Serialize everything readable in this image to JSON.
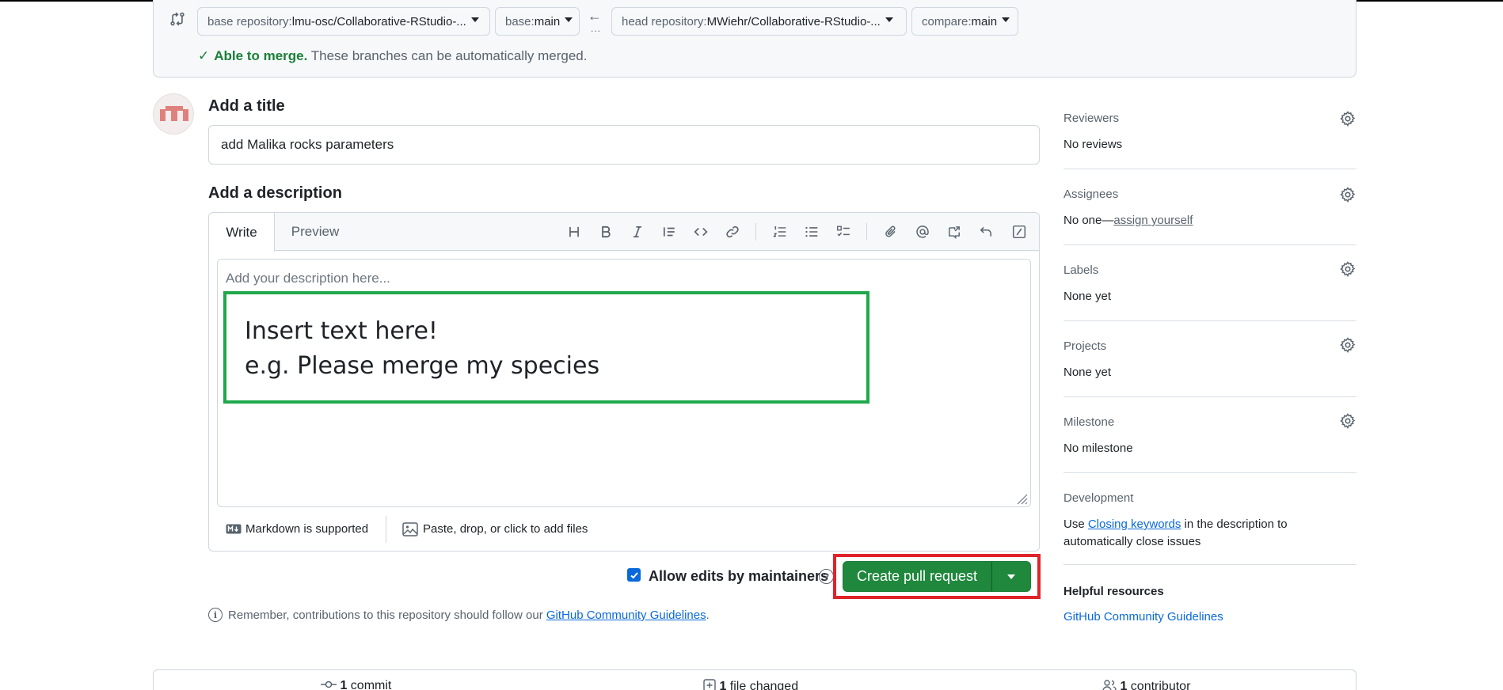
{
  "compare": {
    "base_repo_label": "base repository: ",
    "base_repo_value": "lmu-osc/Collaborative-RStudio-...",
    "base_label": "base: ",
    "base_value": "main",
    "arrow": "←",
    "arrow_dots": "...",
    "head_repo_label": "head repository: ",
    "head_repo_value": "MWiehr/Collaborative-RStudio-...",
    "compare_label": "compare: ",
    "compare_value": "main",
    "merge_ok": "Able to merge.",
    "merge_msg": " These branches can be automatically merged."
  },
  "form": {
    "title_heading": "Add a title",
    "title_value": "add Malika rocks parameters",
    "desc_heading": "Add a description",
    "tab_write": "Write",
    "tab_preview": "Preview",
    "desc_placeholder": "Add your description here...",
    "annotation_line1": "Insert text here!",
    "annotation_line2": "e.g. Please merge my species",
    "markdown_note": "Markdown is supported",
    "attach_note": "Paste, drop, or click to add files",
    "allow_edits": "Allow edits by maintainers",
    "create_button": "Create pull request",
    "remember_text": "Remember, contributions to this repository should follow our ",
    "remember_link": "GitHub Community Guidelines",
    "remember_end": "."
  },
  "toolbar_icons": [
    "heading-icon",
    "bold-icon",
    "italic-icon",
    "quote-icon",
    "code-icon",
    "link-icon",
    "ordered-list-icon",
    "unordered-list-icon",
    "task-list-icon",
    "attach-icon",
    "mention-icon",
    "cross-reference-icon",
    "undo-icon",
    "slash-command-icon"
  ],
  "sidebar": {
    "reviewers_label": "Reviewers",
    "reviewers_value": "No reviews",
    "assignees_label": "Assignees",
    "assignees_value": "No one—",
    "assignees_link": "assign yourself",
    "labels_label": "Labels",
    "labels_value": "None yet",
    "projects_label": "Projects",
    "projects_value": "None yet",
    "milestone_label": "Milestone",
    "milestone_value": "No milestone",
    "development_label": "Development",
    "development_pre": "Use ",
    "development_link": "Closing keywords",
    "development_post": " in the description to automatically close issues",
    "helpful_heading": "Helpful resources",
    "helpful_link": "GitHub Community Guidelines"
  },
  "stats": {
    "commits_count": "1",
    "commits_label": " commit",
    "files_count": "1",
    "files_label": " file changed",
    "contributors_count": "1",
    "contributors_label": " contributor"
  },
  "colors": {
    "success_green": "#1f883d",
    "annotation_green": "#1fa84a",
    "annotation_red": "#e0232a",
    "link_blue": "#0969da"
  }
}
